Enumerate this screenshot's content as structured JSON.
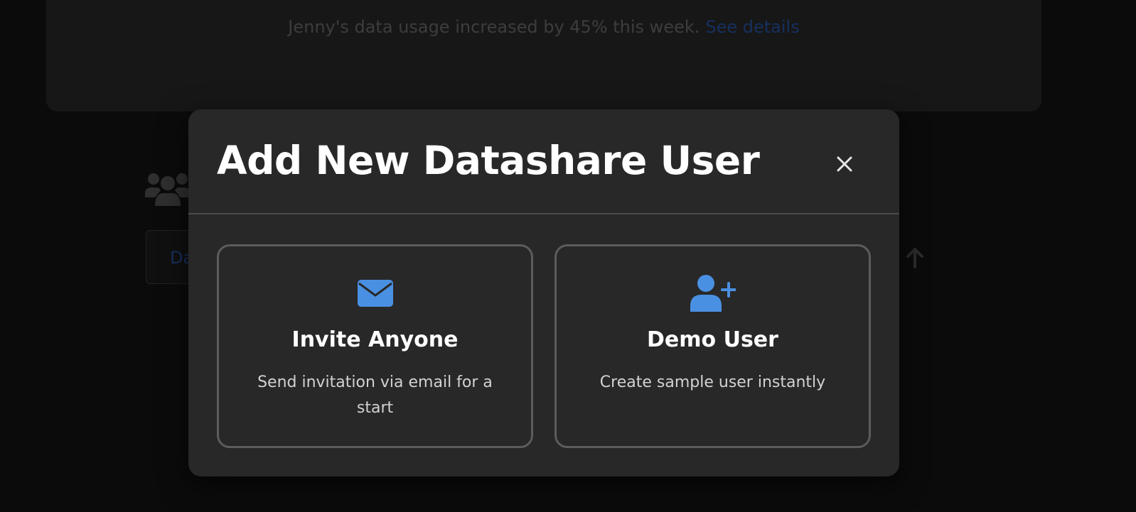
{
  "background": {
    "notice": {
      "text": "Jenny's data usage increased by 45% this week.",
      "link": "See details"
    },
    "tab_label": "Da",
    "icons": [
      "users-icon",
      "arrow-up-icon"
    ]
  },
  "modal": {
    "title": "Add New Datashare User",
    "close_icon": "close-icon",
    "options": [
      {
        "icon": "envelope-icon",
        "title": "Invite Anyone",
        "description": "Send invitation via email for a start"
      },
      {
        "icon": "user-plus-icon",
        "title": "Demo User",
        "description": "Create sample user instantly"
      }
    ]
  },
  "colors": {
    "accent": "#4a90e2",
    "modal_bg": "#282828",
    "backdrop": "#0b0b0b"
  }
}
